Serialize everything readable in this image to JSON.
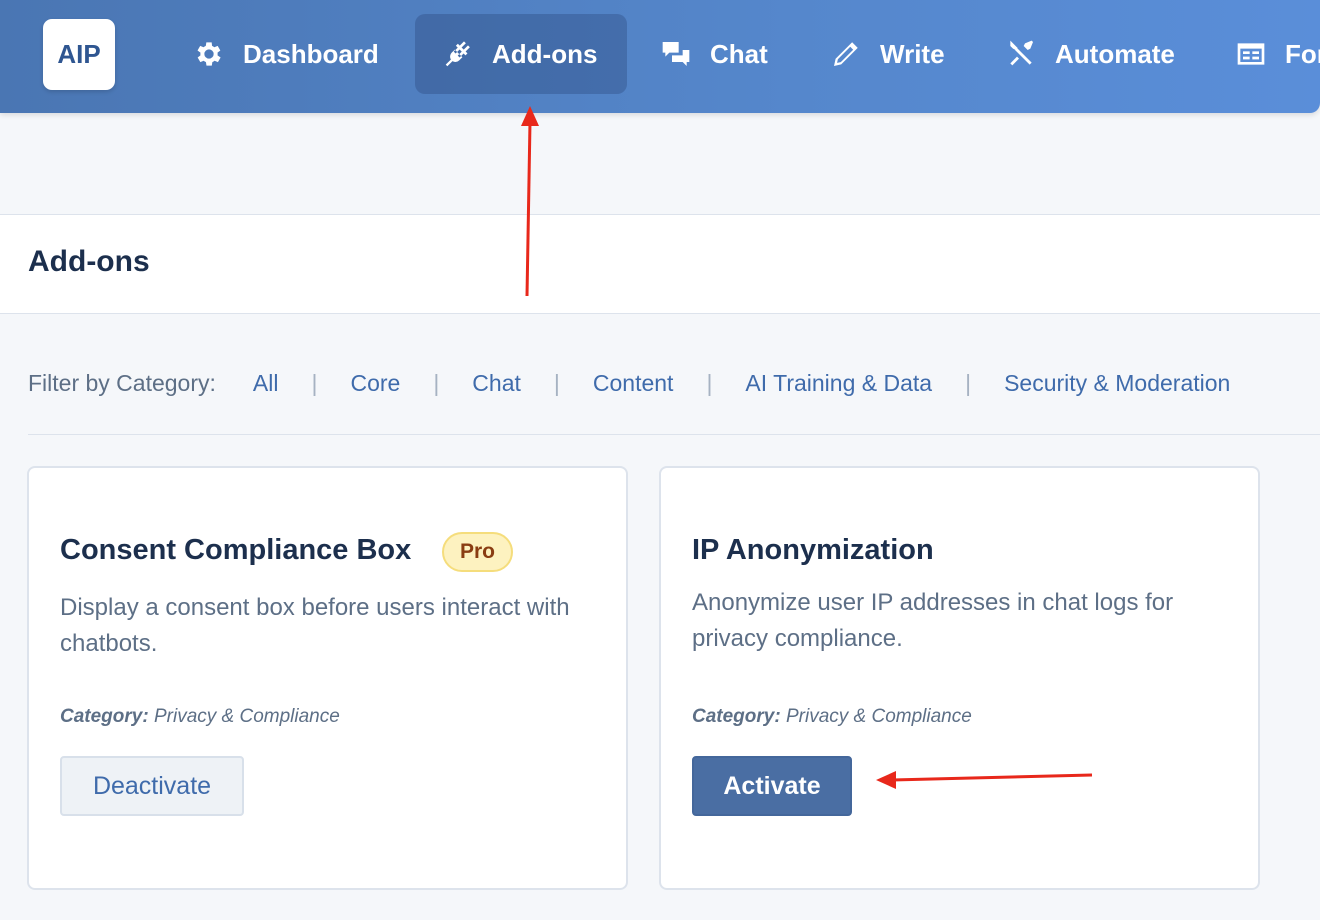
{
  "app": {
    "logo_text": "AIP"
  },
  "nav": {
    "items": [
      {
        "label": "Dashboard",
        "icon": "gear-icon",
        "active": false
      },
      {
        "label": "Add-ons",
        "icon": "plug-icon",
        "active": true
      },
      {
        "label": "Chat",
        "icon": "chat-bubbles-icon",
        "active": false
      },
      {
        "label": "Write",
        "icon": "pencil-icon",
        "active": false
      },
      {
        "label": "Automate",
        "icon": "tools-icon",
        "active": false
      },
      {
        "label": "Forms",
        "icon": "form-icon",
        "active": false
      }
    ]
  },
  "page": {
    "title": "Add-ons"
  },
  "filter": {
    "label": "Filter by Category:",
    "categories": [
      "All",
      "Core",
      "Chat",
      "Content",
      "AI Training & Data",
      "Security & Moderation"
    ],
    "separator": "|"
  },
  "cards": [
    {
      "title": "Consent Compliance Box",
      "badge": "Pro",
      "description": "Display a consent box before users interact with chatbots.",
      "category_label": "Category:",
      "category_value": "Privacy & Compliance",
      "button_label": "Deactivate"
    },
    {
      "title": "IP Anonymization",
      "badge": "",
      "description": "Anonymize user IP addresses in chat logs for privacy compliance.",
      "category_label": "Category:",
      "category_value": "Privacy & Compliance",
      "button_label": "Activate"
    }
  ],
  "colors": {
    "nav_gradient_start": "#4a76b3",
    "nav_gradient_end": "#5a8ed9",
    "activate_button": "#4a6ea3",
    "badge_bg": "#fdf2c0",
    "annotation_arrow": "#e8281b"
  }
}
